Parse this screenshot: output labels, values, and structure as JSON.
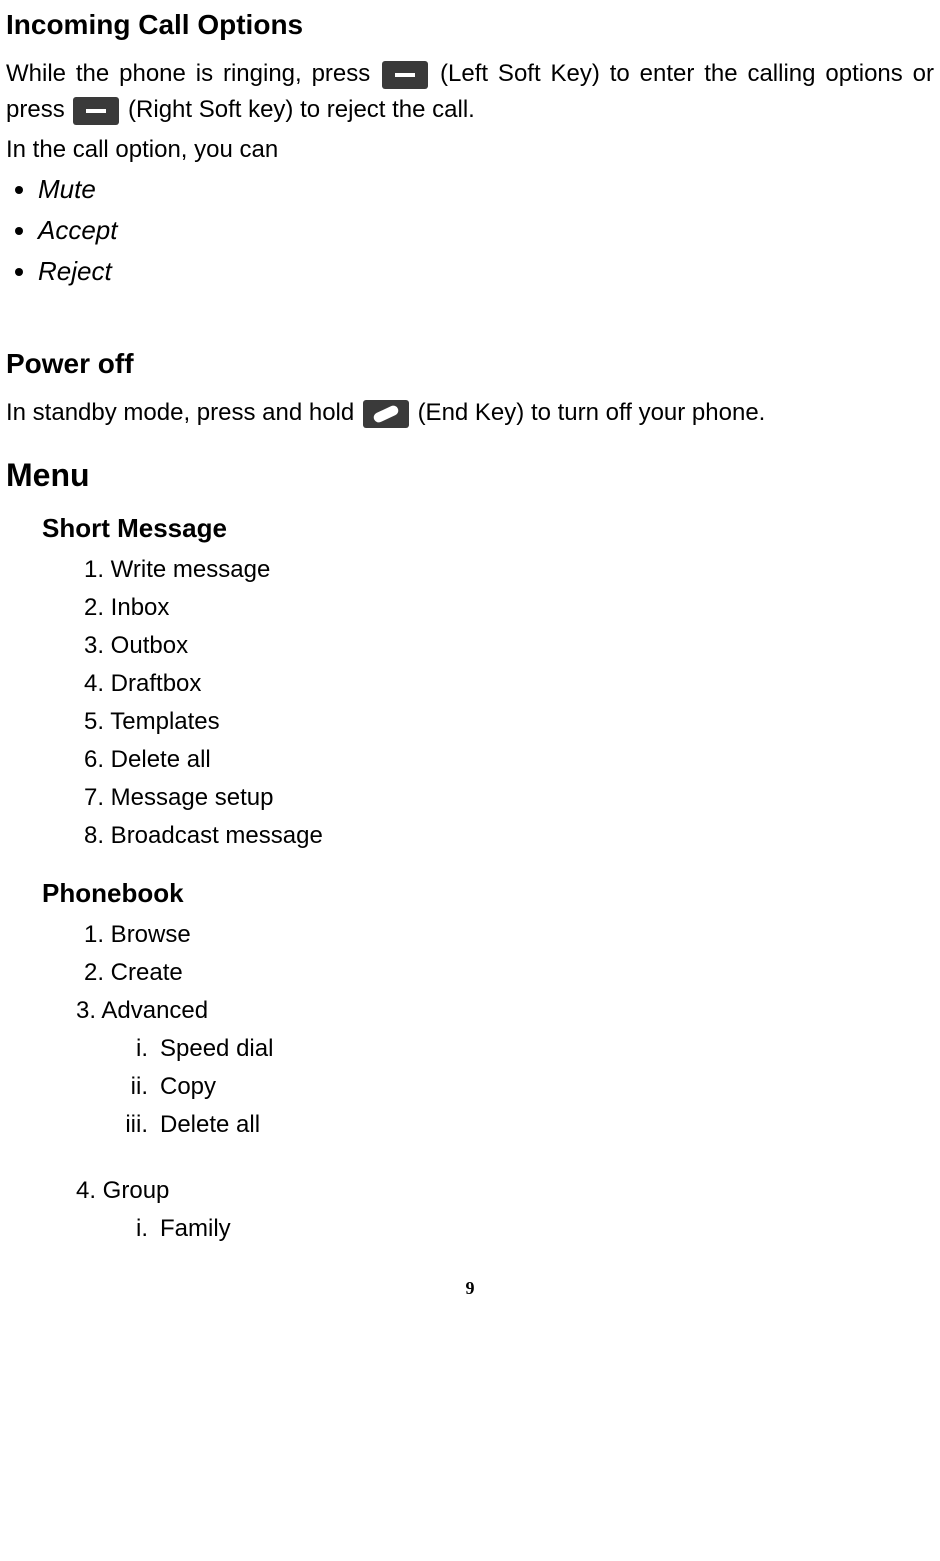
{
  "heading_incoming": "Incoming Call Options",
  "incoming_para_1a": "While the phone is ringing, press ",
  "incoming_para_1b": "(Left Soft Key) to enter the calling options or press ",
  "incoming_para_1c": "(Right Soft key) to reject the call.",
  "incoming_line2": "In the call option, you can",
  "bullets": {
    "mute": "Mute",
    "accept": "Accept",
    "reject": "Reject"
  },
  "heading_poweroff": "Power off",
  "poweroff_1a": "In standby mode, press and hold ",
  "poweroff_1b": "(End Key) to turn off your phone.",
  "heading_menu": "Menu",
  "short_message": {
    "title": "Short Message",
    "items": [
      "1. Write message",
      "2. Inbox",
      "3. Outbox",
      "4. Draftbox",
      "5. Templates",
      "6. Delete all",
      "7. Message setup",
      "8. Broadcast message"
    ]
  },
  "phonebook": {
    "title": "Phonebook",
    "item1": "1. Browse",
    "item2": "2. Create",
    "item3": "3. Advanced",
    "advanced": {
      "i_label": "i.",
      "i_text": "Speed dial",
      "ii_label": "ii.",
      "ii_text": "Copy",
      "iii_label": "iii.",
      "iii_text": "Delete all"
    },
    "item4": "4. Group",
    "group": {
      "i_label": "i.",
      "i_text": "Family"
    }
  },
  "page_number": "9"
}
